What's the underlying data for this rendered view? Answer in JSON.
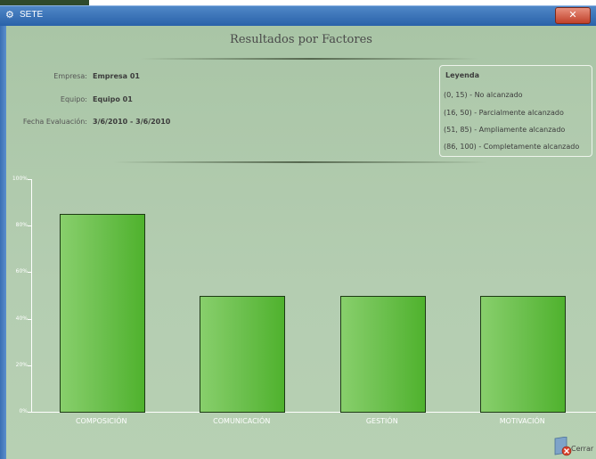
{
  "window": {
    "title": "SETE",
    "close_glyph": "✕"
  },
  "page": {
    "title": "Resultados por Factores"
  },
  "info": {
    "empresa_label": "Empresa:",
    "empresa_value": "Empresa 01",
    "equipo_label": "Equipo:",
    "equipo_value": "Equipo 01",
    "fecha_label": "Fecha Evaluación:",
    "fecha_value": "3/6/2010 - 3/6/2010"
  },
  "legend": {
    "title": "Leyenda",
    "items": [
      "(0, 15) - No alcanzado",
      "(16, 50) - Parcialmente alcanzado",
      "(51, 85) - Ampliamente alcanzado",
      "(86, 100) - Completamente alcanzado"
    ]
  },
  "chart_data": {
    "type": "bar",
    "categories": [
      "COMPOSICIÓN",
      "COMUNICACIÓN",
      "GESTIÓN",
      "MOTIVACIÓN"
    ],
    "values": [
      85,
      50,
      50,
      50
    ],
    "yticks": [
      "0%",
      "20%",
      "40%",
      "60%",
      "80%",
      "100%"
    ],
    "ylim": [
      0,
      100
    ],
    "bar_color": "#6cc04e"
  },
  "footer": {
    "close_label": "Cerrar"
  }
}
